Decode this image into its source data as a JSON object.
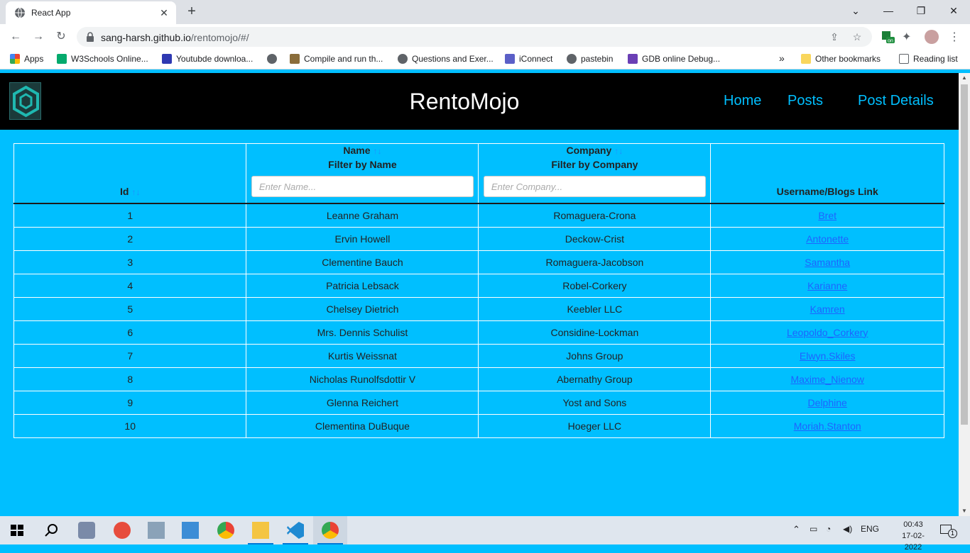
{
  "browser": {
    "tab_title": "React App",
    "url_host": "sang-harsh.github.io",
    "url_path": "/rentomojo/#/",
    "bookmarks": [
      {
        "label": "Apps",
        "color": "#ea4335"
      },
      {
        "label": "W3Schools Online...",
        "color": "#04aa6d"
      },
      {
        "label": "Youtubde downloa...",
        "color": "#2f39b2"
      },
      {
        "label": "",
        "color": "#5f6368"
      },
      {
        "label": "Compile and run th...",
        "color": "#8a6d3b"
      },
      {
        "label": "Questions and Exer...",
        "color": "#5f6368"
      },
      {
        "label": "iConnect",
        "color": "#5b5fc7"
      },
      {
        "label": "pastebin",
        "color": "#5f6368"
      },
      {
        "label": "GDB online Debug...",
        "color": "#6a3fb5"
      }
    ],
    "other_bookmarks": "Other bookmarks",
    "reading_list": "Reading list",
    "overflow": "»",
    "ext_badge": "on"
  },
  "site": {
    "brand": "RentoMojo",
    "nav": [
      "Home",
      "Posts",
      "Post Details"
    ]
  },
  "table": {
    "headers": {
      "id": "Id",
      "name": "Name",
      "name_filter_label": "Filter by Name",
      "name_placeholder": "Enter Name...",
      "company": "Company",
      "company_filter_label": "Filter by Company",
      "company_placeholder": "Enter Company...",
      "username": "Username/Blogs Link",
      "sort_glyph": "↑↓"
    },
    "rows": [
      {
        "id": "1",
        "name": "Leanne Graham",
        "company": "Romaguera-Crona",
        "username": "Bret"
      },
      {
        "id": "2",
        "name": "Ervin Howell",
        "company": "Deckow-Crist",
        "username": "Antonette"
      },
      {
        "id": "3",
        "name": "Clementine Bauch",
        "company": "Romaguera-Jacobson",
        "username": "Samantha"
      },
      {
        "id": "4",
        "name": "Patricia Lebsack",
        "company": "Robel-Corkery",
        "username": "Karianne"
      },
      {
        "id": "5",
        "name": "Chelsey Dietrich",
        "company": "Keebler LLC",
        "username": "Kamren"
      },
      {
        "id": "6",
        "name": "Mrs. Dennis Schulist",
        "company": "Considine-Lockman",
        "username": "Leopoldo_Corkery"
      },
      {
        "id": "7",
        "name": "Kurtis Weissnat",
        "company": "Johns Group",
        "username": "Elwyn.Skiles"
      },
      {
        "id": "8",
        "name": "Nicholas Runolfsdottir V",
        "company": "Abernathy Group",
        "username": "Maxime_Nienow"
      },
      {
        "id": "9",
        "name": "Glenna Reichert",
        "company": "Yost and Sons",
        "username": "Delphine"
      },
      {
        "id": "10",
        "name": "Clementina DuBuque",
        "company": "Hoeger LLC",
        "username": "Moriah.Stanton"
      }
    ]
  },
  "taskbar": {
    "lang": "ENG",
    "time": "00:43",
    "date": "17-02-2022",
    "notif_count": "1"
  },
  "colors": {
    "page_bg": "#00bfff",
    "header_bg": "#000000",
    "nav_link": "#00bfff",
    "user_link": "#1e64ff"
  }
}
